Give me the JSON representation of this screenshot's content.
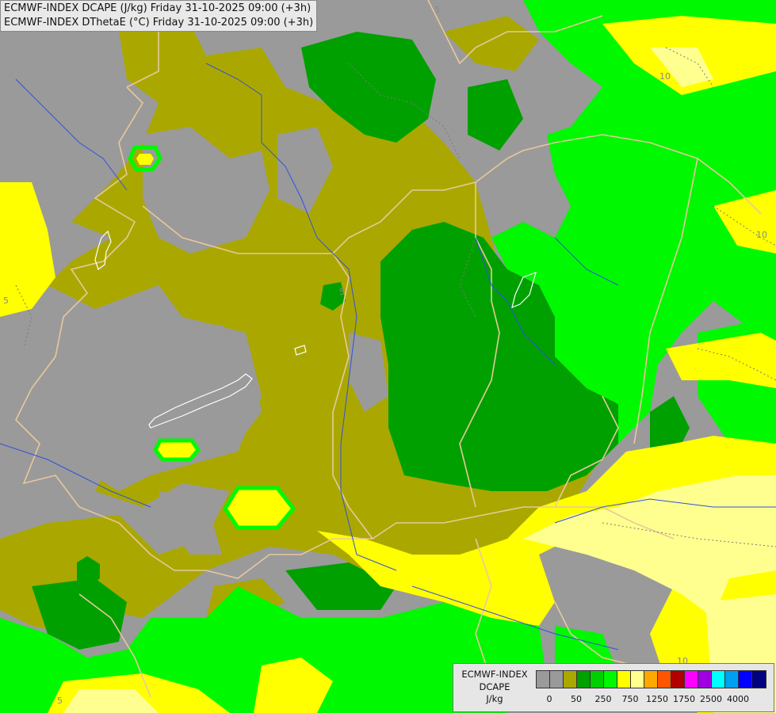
{
  "titles": {
    "line1": "ECMWF-INDEX DCAPE (J/kg) Friday 31-10-2025 09:00 (+3h)",
    "line2": "ECMWF-INDEX DThetaE (°C) Friday 31-10-2025 09:00 (+3h)"
  },
  "contour_labels": [
    "5",
    "5",
    "10",
    "10",
    "5",
    "10",
    "5"
  ],
  "legend": {
    "line1": "ECMWF-INDEX",
    "line2": "DCAPE",
    "line3": "J/kg",
    "colors": [
      "#9a9a9a",
      "#9a9a9a",
      "#aaa800",
      "#00a000",
      "#00d000",
      "#00f800",
      "#ffff00",
      "#ffff90",
      "#ffa800",
      "#ff5400",
      "#b00000",
      "#ff00ff",
      "#a000e0",
      "#00ffff",
      "#00a0f0",
      "#0000ff",
      "#000080"
    ],
    "ticks": [
      "0",
      "50",
      "250",
      "750",
      "1250",
      "1750",
      "2500",
      "4000"
    ]
  },
  "colors": {
    "gray": "#9a9a9a",
    "olive": "#aaa800",
    "dark_green": "#00a000",
    "green": "#00d000",
    "bright_green": "#00f800",
    "yellow": "#ffff00",
    "light_yellow": "#ffff90",
    "border": "#e8c89c",
    "river": "#3050e0"
  }
}
